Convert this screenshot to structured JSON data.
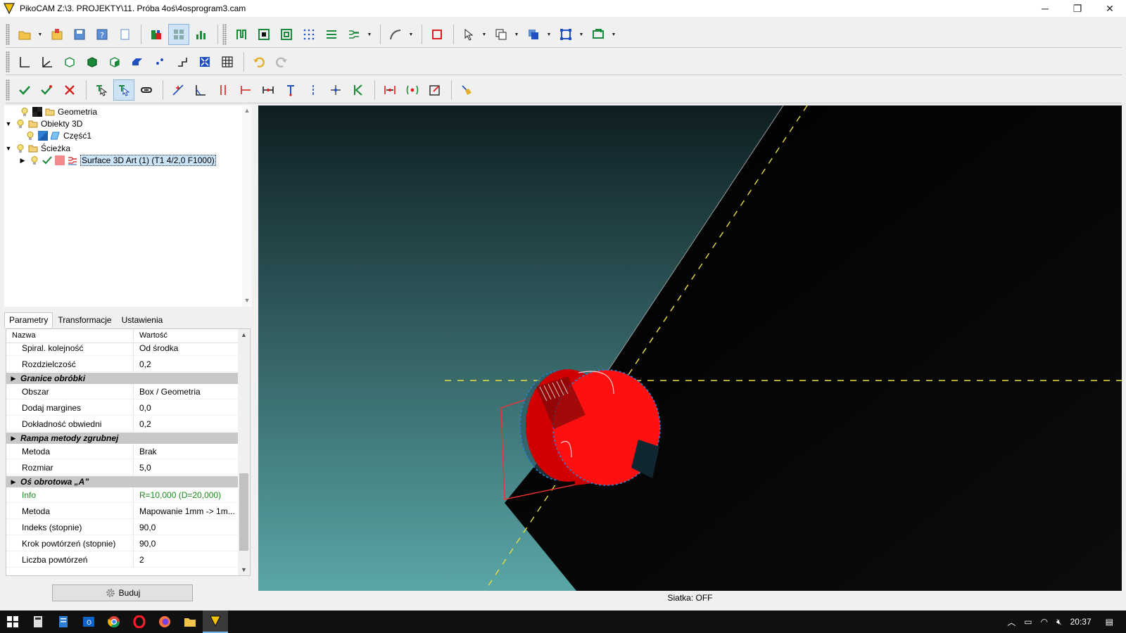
{
  "window": {
    "title": "PikoCAM  Z:\\3. PROJEKTY\\11. Próba 4oś\\4osprogram3.cam",
    "minimize": "─",
    "restore": "❐",
    "close": "✕"
  },
  "tree": {
    "items": [
      {
        "label": "Geometria"
      },
      {
        "label": "Obiekty 3D"
      },
      {
        "label": "Część1"
      },
      {
        "label": "Ścieżka"
      },
      {
        "label": "Surface 3D Art (1) (T1 4/2,0 F1000)"
      }
    ]
  },
  "tabs": [
    {
      "label": "Parametry"
    },
    {
      "label": "Transformacje"
    },
    {
      "label": "Ustawienia"
    }
  ],
  "props": {
    "header": {
      "name": "Nazwa",
      "value": "Wartość"
    },
    "rows": [
      {
        "name": "Spiral. kolejność",
        "value": "Od środka"
      },
      {
        "name": "Rozdzielczość",
        "value": "0,2"
      },
      {
        "name": "Obszar",
        "value": "Box / Geometria"
      },
      {
        "name": "Dodaj margines",
        "value": "0,0"
      },
      {
        "name": "Dokładność obwiedni",
        "value": "0,2"
      },
      {
        "name": "Metoda",
        "value": "Brak"
      },
      {
        "name": "Rozmiar",
        "value": "5,0"
      },
      {
        "name": "Info",
        "value": "R=10,000 (D=20,000)"
      },
      {
        "name": "Metoda",
        "value": "Mapowanie 1mm -> 1m..."
      },
      {
        "name": "Indeks (stopnie)",
        "value": "90,0"
      },
      {
        "name": "Krok powtórzeń (stopnie)",
        "value": "90,0"
      },
      {
        "name": "Liczba powtórzeń",
        "value": "2"
      }
    ],
    "categories": [
      {
        "label": "Granice obróbki"
      },
      {
        "label": "Rampa metody zgrubnej"
      },
      {
        "label": "Oś obrotowa „A”"
      }
    ]
  },
  "build_button": {
    "label": "Buduj"
  },
  "statusbar": {
    "text": "Siatka: OFF"
  },
  "taskbar": {
    "time": "20:37"
  },
  "colors": {
    "accent": "#0078d7",
    "viewport_bg_top": "#0e1e22",
    "viewport_bg_bottom": "#5aa6a6",
    "tool_red": "#ff1010",
    "guide_yellow": "#e8e040"
  }
}
